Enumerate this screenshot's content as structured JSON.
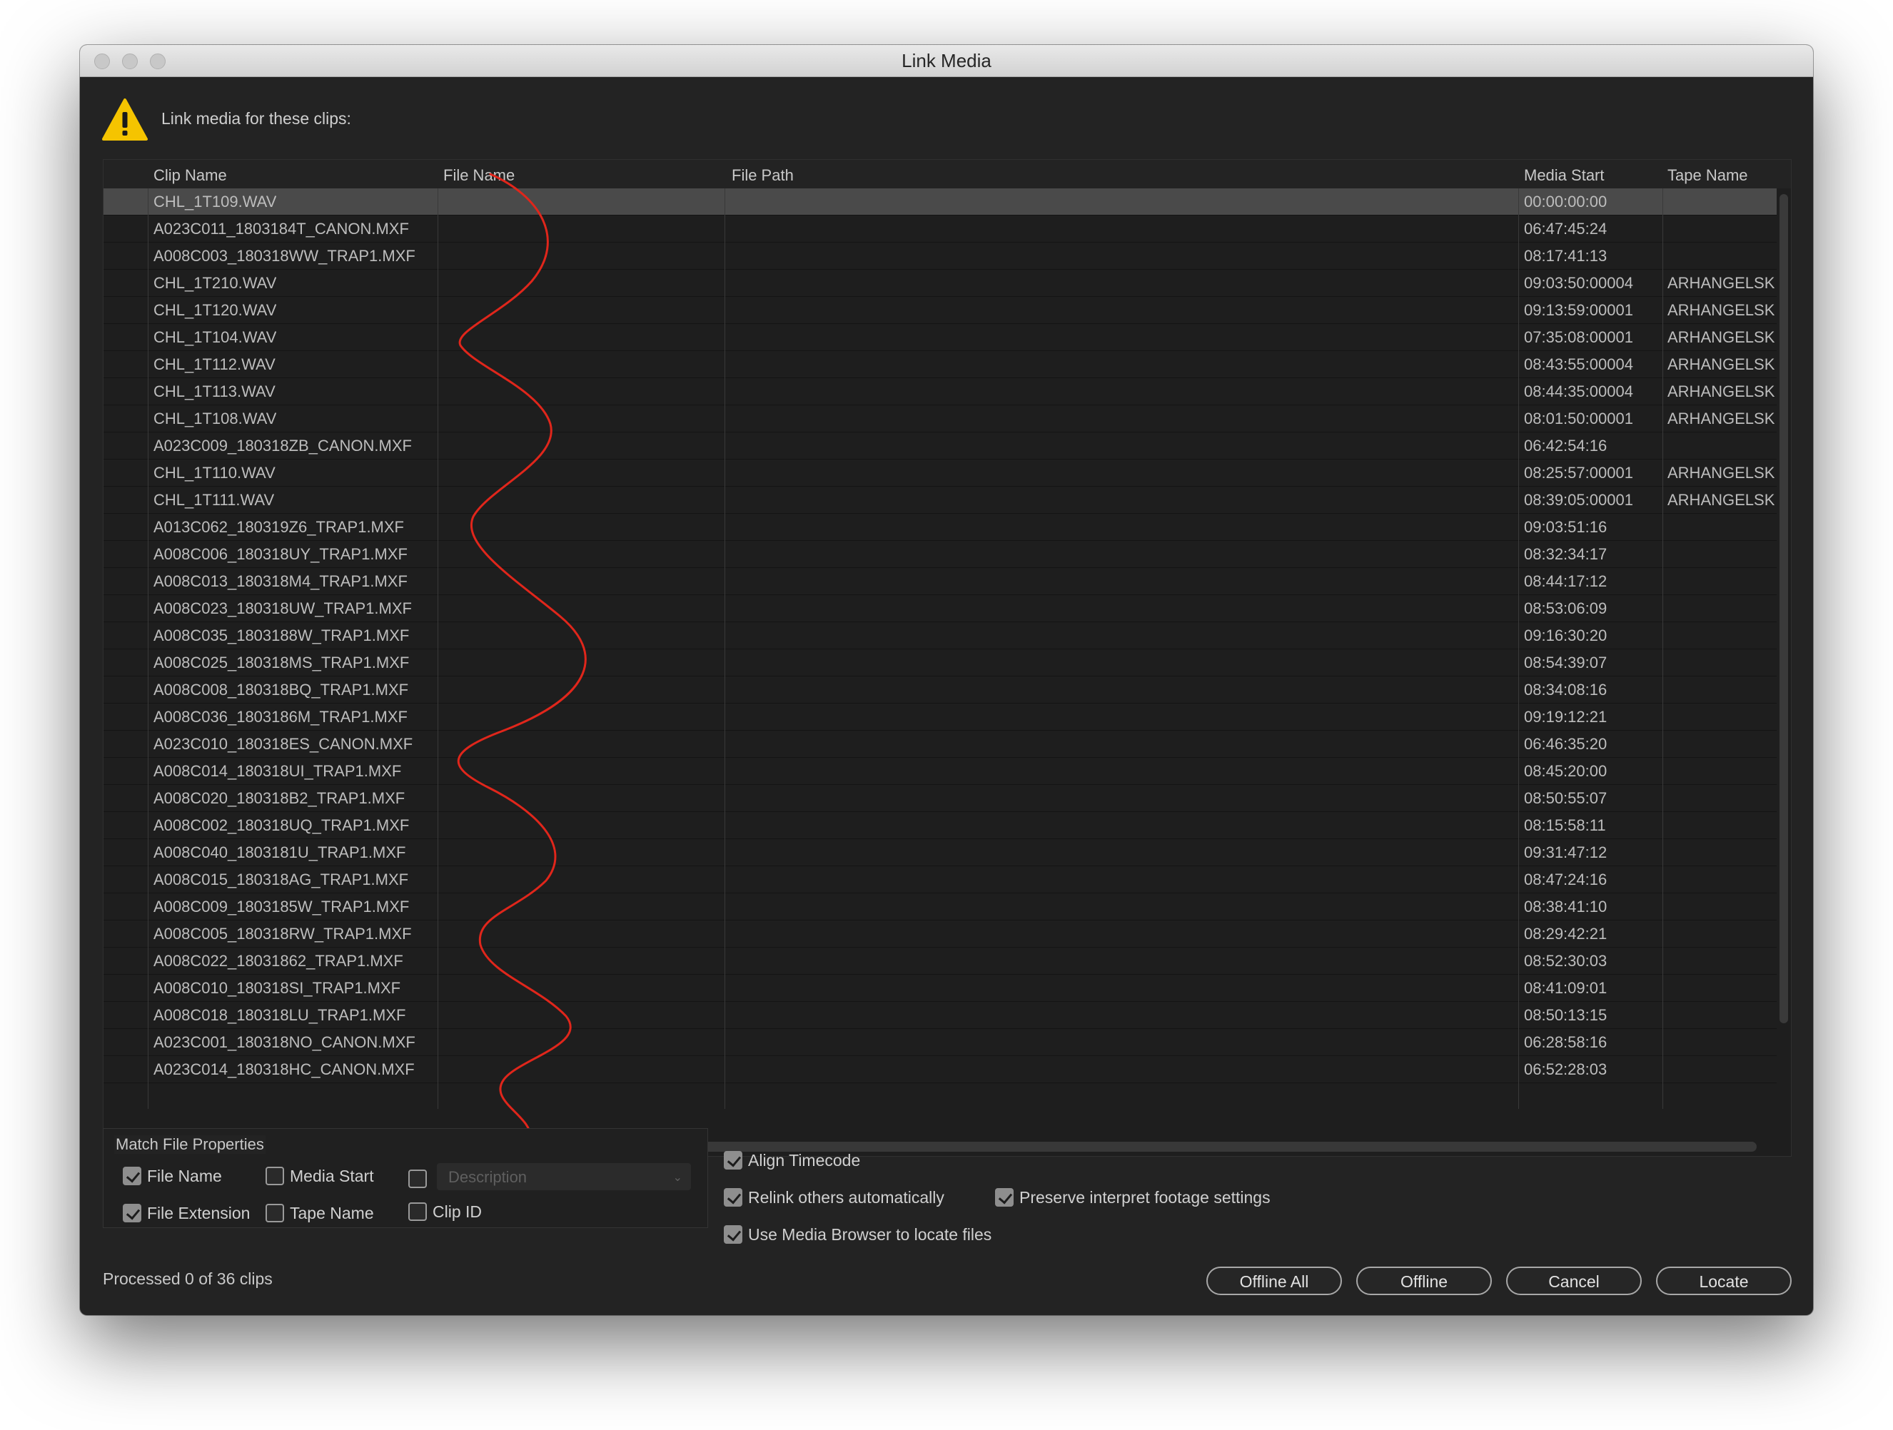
{
  "window": {
    "title": "Link Media"
  },
  "message": "Link media for these clips:",
  "table": {
    "columns": [
      "Clip Name",
      "File Name",
      "File Path",
      "Media Start",
      "Tape Name"
    ],
    "rows": [
      [
        "CHL_1T109.WAV",
        "",
        "",
        "00:00:00:00",
        ""
      ],
      [
        "A023C011_1803184T_CANON.MXF",
        "",
        "",
        "06:47:45:24",
        ""
      ],
      [
        "A008C003_180318WW_TRAP1.MXF",
        "",
        "",
        "08:17:41:13",
        ""
      ],
      [
        "CHL_1T210.WAV",
        "",
        "",
        "09:03:50:00004",
        "ARHANGELSK"
      ],
      [
        "CHL_1T120.WAV",
        "",
        "",
        "09:13:59:00001",
        "ARHANGELSK"
      ],
      [
        "CHL_1T104.WAV",
        "",
        "",
        "07:35:08:00001",
        "ARHANGELSK"
      ],
      [
        "CHL_1T112.WAV",
        "",
        "",
        "08:43:55:00004",
        "ARHANGELSK"
      ],
      [
        "CHL_1T113.WAV",
        "",
        "",
        "08:44:35:00004",
        "ARHANGELSK"
      ],
      [
        "CHL_1T108.WAV",
        "",
        "",
        "08:01:50:00001",
        "ARHANGELSK"
      ],
      [
        "A023C009_180318ZB_CANON.MXF",
        "",
        "",
        "06:42:54:16",
        ""
      ],
      [
        "CHL_1T110.WAV",
        "",
        "",
        "08:25:57:00001",
        "ARHANGELSK"
      ],
      [
        "CHL_1T111.WAV",
        "",
        "",
        "08:39:05:00001",
        "ARHANGELSK"
      ],
      [
        "A013C062_180319Z6_TRAP1.MXF",
        "",
        "",
        "09:03:51:16",
        ""
      ],
      [
        "A008C006_180318UY_TRAP1.MXF",
        "",
        "",
        "08:32:34:17",
        ""
      ],
      [
        "A008C013_180318M4_TRAP1.MXF",
        "",
        "",
        "08:44:17:12",
        ""
      ],
      [
        "A008C023_180318UW_TRAP1.MXF",
        "",
        "",
        "08:53:06:09",
        ""
      ],
      [
        "A008C035_1803188W_TRAP1.MXF",
        "",
        "",
        "09:16:30:20",
        ""
      ],
      [
        "A008C025_180318MS_TRAP1.MXF",
        "",
        "",
        "08:54:39:07",
        ""
      ],
      [
        "A008C008_180318BQ_TRAP1.MXF",
        "",
        "",
        "08:34:08:16",
        ""
      ],
      [
        "A008C036_1803186M_TRAP1.MXF",
        "",
        "",
        "09:19:12:21",
        ""
      ],
      [
        "A023C010_180318ES_CANON.MXF",
        "",
        "",
        "06:46:35:20",
        ""
      ],
      [
        "A008C014_180318UI_TRAP1.MXF",
        "",
        "",
        "08:45:20:00",
        ""
      ],
      [
        "A008C020_180318B2_TRAP1.MXF",
        "",
        "",
        "08:50:55:07",
        ""
      ],
      [
        "A008C002_180318UQ_TRAP1.MXF",
        "",
        "",
        "08:15:58:11",
        ""
      ],
      [
        "A008C040_1803181U_TRAP1.MXF",
        "",
        "",
        "09:31:47:12",
        ""
      ],
      [
        "A008C015_180318AG_TRAP1.MXF",
        "",
        "",
        "08:47:24:16",
        ""
      ],
      [
        "A008C009_1803185W_TRAP1.MXF",
        "",
        "",
        "08:38:41:10",
        ""
      ],
      [
        "A008C005_180318RW_TRAP1.MXF",
        "",
        "",
        "08:29:42:21",
        ""
      ],
      [
        "A008C022_18031862_TRAP1.MXF",
        "",
        "",
        "08:52:30:03",
        ""
      ],
      [
        "A008C010_180318SI_TRAP1.MXF",
        "",
        "",
        "08:41:09:01",
        ""
      ],
      [
        "A008C018_180318LU_TRAP1.MXF",
        "",
        "",
        "08:50:13:15",
        ""
      ],
      [
        "A023C001_180318NO_CANON.MXF",
        "",
        "",
        "06:28:58:16",
        ""
      ],
      [
        "A023C014_180318HC_CANON.MXF",
        "",
        "",
        "06:52:28:03",
        ""
      ]
    ]
  },
  "match_properties": {
    "label": "Match File Properties",
    "file_name": "File Name",
    "file_extension": "File Extension",
    "media_start": "Media Start",
    "tape_name": "Tape Name",
    "description": "Description",
    "clip_id": "Clip ID"
  },
  "options": {
    "align_timecode": "Align Timecode",
    "relink_others": "Relink others automatically",
    "use_media_browser": "Use Media Browser to locate files",
    "preserve_interpret": "Preserve interpret footage settings"
  },
  "status": "Processed 0 of 36 clips",
  "buttons": {
    "offline_all": "Offline All",
    "offline": "Offline",
    "cancel": "Cancel",
    "locate": "Locate"
  },
  "colors": {
    "window_bg": "#232323",
    "selected_row": "#4a4a4a",
    "annotation": "#e0261b",
    "warning": "#f5c400"
  }
}
